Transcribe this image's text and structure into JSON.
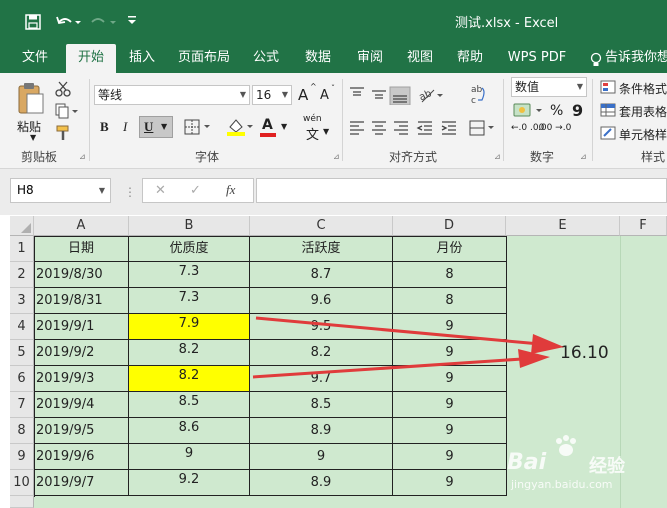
{
  "titlebar": {
    "title": "测试.xlsx  -  Excel",
    "colors": {
      "excel_green": "#217346"
    }
  },
  "tabs": [
    "文件",
    "开始",
    "插入",
    "页面布局",
    "公式",
    "数据",
    "审阅",
    "视图",
    "帮助",
    "WPS PDF",
    "告诉我你想"
  ],
  "ribbon": {
    "paste": "粘贴",
    "clipboard": "剪贴板",
    "font_name": "等线",
    "font_size": "16",
    "font_group": "字体",
    "wen": "wén",
    "wen_char": "文",
    "align_group": "对齐方式",
    "number_format": "数值",
    "number_group": "数字",
    "cond_format": "条件格式",
    "table_format": "套用表格",
    "cell_style": "单元格样",
    "styles_group": "样式",
    "increase_font": "A",
    "decrease_font": "A",
    "bold": "B",
    "italic": "I",
    "underline": "U",
    "font_color_a": "A",
    "percent": "%",
    "comma": "9",
    "abc": "ab",
    "abc2": "c",
    "dec_inc": "←.0 .00",
    "dec_dec": ".00 →.0"
  },
  "formula_bar": {
    "name_box": "H8",
    "fx": "fx",
    "cancel": "✕",
    "enter": "✓"
  },
  "sheet": {
    "columns": [
      "A",
      "B",
      "C",
      "D",
      "E",
      "F"
    ],
    "header": [
      "日期",
      "优质度",
      "活跃度",
      "月份"
    ],
    "rows": [
      {
        "num": "1"
      },
      {
        "num": "2",
        "date": "2019/8/30",
        "q": "7.3",
        "a": "8.7",
        "m": "8"
      },
      {
        "num": "3",
        "date": "2019/8/31",
        "q": "7.3",
        "a": "9.6",
        "m": "8"
      },
      {
        "num": "4",
        "date": "2019/9/1",
        "q": "7.9",
        "a": "9.5",
        "m": "9"
      },
      {
        "num": "5",
        "date": "2019/9/2",
        "q": "8.2",
        "a": "8.2",
        "m": "9"
      },
      {
        "num": "6",
        "date": "2019/9/3",
        "q": "8.2",
        "a": "9.7",
        "m": "9"
      },
      {
        "num": "7",
        "date": "2019/9/4",
        "q": "8.5",
        "a": "8.5",
        "m": "9"
      },
      {
        "num": "8",
        "date": "2019/9/5",
        "q": "8.6",
        "a": "8.9",
        "m": "9"
      },
      {
        "num": "9",
        "date": "2019/9/6",
        "q": "9",
        "a": "9",
        "m": "9"
      },
      {
        "num": "10",
        "date": "2019/9/7",
        "q": "9.2",
        "a": "8.9",
        "m": "9"
      }
    ],
    "e5_value": "16.10",
    "colors": {
      "sheet_bg": "#cfe9cf",
      "highlight": "#ffff00",
      "arrow": "#e03b3b"
    }
  },
  "watermark": {
    "brand": "Bai",
    "brand2": "经验",
    "url": "jingyan.baidu.com"
  }
}
